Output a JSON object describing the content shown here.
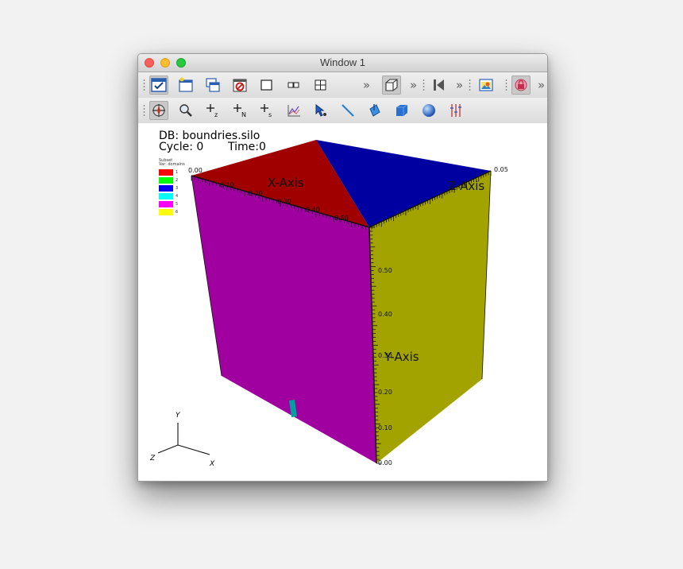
{
  "window": {
    "title": "Window 1"
  },
  "toolbar1": {
    "buttons": [
      {
        "icon": "checkbox-window-icon"
      },
      {
        "icon": "new-window-icon"
      },
      {
        "icon": "copy-window-icon"
      },
      {
        "icon": "delete-window-icon"
      },
      {
        "icon": "layout-1x1-icon"
      },
      {
        "icon": "layout-1x2-icon"
      },
      {
        "icon": "layout-2x2-icon"
      },
      {
        "icon": "view-3d-icon"
      },
      {
        "icon": "animation-back-icon"
      },
      {
        "icon": "picture-icon"
      },
      {
        "icon": "lock-view-icon"
      }
    ],
    "overflow": "»"
  },
  "toolbar2": {
    "buttons": [
      {
        "icon": "navigate-icon"
      },
      {
        "icon": "zoom-icon"
      },
      {
        "icon": "zone-pick-icon",
        "label": "z"
      },
      {
        "icon": "node-pick-icon",
        "label": "N"
      },
      {
        "icon": "spreadsheet-pick-icon",
        "label": "s"
      },
      {
        "icon": "curve-lineout-icon"
      },
      {
        "icon": "pick-pointer-icon"
      },
      {
        "icon": "line-tool-icon"
      },
      {
        "icon": "plane-tool-icon"
      },
      {
        "icon": "box-tool-icon"
      },
      {
        "icon": "sphere-tool-icon"
      },
      {
        "icon": "axis-restrict-icon"
      }
    ]
  },
  "hud": {
    "db": "DB: boundries.silo",
    "cycle": "Cycle: 0",
    "time": "Time:0"
  },
  "legend": {
    "title1": "Subset",
    "title2": "Var: domains",
    "items": [
      {
        "label": "1",
        "color": "#ff0000"
      },
      {
        "label": "2",
        "color": "#00ff00"
      },
      {
        "label": "3",
        "color": "#0000ff"
      },
      {
        "label": "4",
        "color": "#00ffff"
      },
      {
        "label": "5",
        "color": "#ff00ff"
      },
      {
        "label": "6",
        "color": "#ffff00"
      }
    ]
  },
  "plot": {
    "axis_titles": {
      "x": "X-Axis",
      "y": "Y-Axis",
      "z": "Z-Axis"
    },
    "x_ticks": [
      "0.00",
      "0.10",
      "0.20",
      "0.30",
      "0.40",
      "0.50"
    ],
    "y_ticks": [
      "0.00",
      "0.10",
      "0.20",
      "0.30",
      "0.40",
      "0.50"
    ],
    "z_ticks": [
      "0.05"
    ],
    "face_colors": {
      "front": "#a000a0",
      "right": "#a3a300",
      "top_left": "#a00000",
      "top_right": "#0000a0",
      "marker": "#00a0a0"
    }
  },
  "triad": {
    "x": "X",
    "y": "Y",
    "z": "Z"
  }
}
